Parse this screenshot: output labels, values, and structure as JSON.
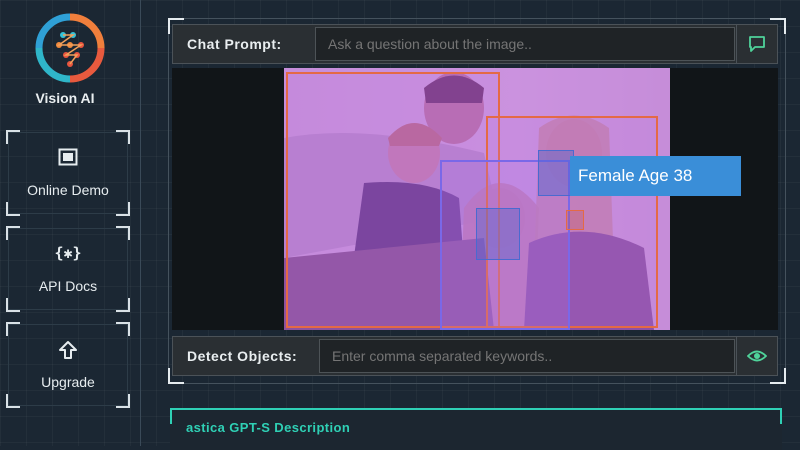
{
  "brand": {
    "name": "Vision AI"
  },
  "sidebar": {
    "items": [
      {
        "label": "Online Demo",
        "icon": "image-frame-icon"
      },
      {
        "label": "API Docs",
        "icon": "code-braces-icon"
      },
      {
        "label": "Upgrade",
        "icon": "arrow-up-icon"
      }
    ]
  },
  "chat": {
    "label": "Chat Prompt:",
    "placeholder": "Ask a question about the image..",
    "send_icon": "chat-bubble-icon"
  },
  "detect": {
    "label": "Detect Objects:",
    "placeholder": "Enter comma separated keywords..",
    "view_icon": "eye-icon"
  },
  "detection": {
    "tooltip": "Female Age 38"
  },
  "description": {
    "title": "astica GPT-S Description"
  },
  "colors": {
    "accent_teal": "#2fd0b5",
    "box_orange": "#e46a45",
    "tooltip_blue": "#3a8ed8"
  }
}
